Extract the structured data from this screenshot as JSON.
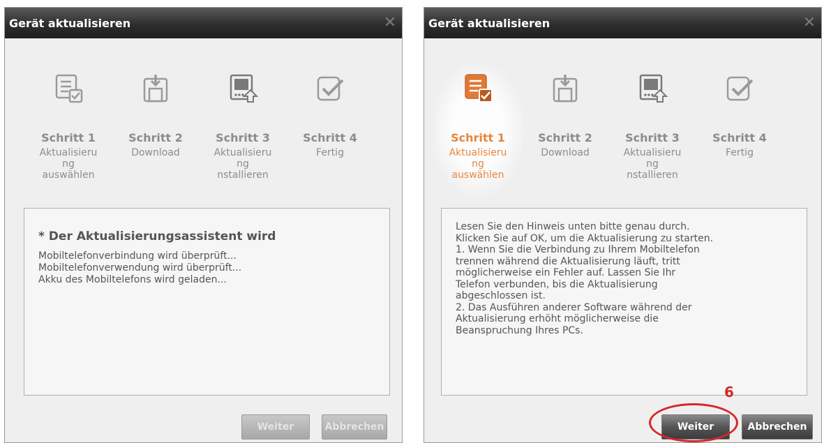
{
  "dialogs": [
    {
      "title": "Gerät aktualisieren",
      "close_symbol": "✕",
      "steps": [
        {
          "name": "Schritt 1",
          "desc_lines": [
            "Aktualisieru",
            "ng",
            "auswählen"
          ],
          "icon": "checklist-icon"
        },
        {
          "name": "Schritt 2",
          "desc_lines": [
            "Download"
          ],
          "icon": "download-icon"
        },
        {
          "name": "Schritt 3",
          "desc_lines": [
            "Aktualisieru",
            "ng",
            "nstallieren"
          ],
          "icon": "install-icon"
        },
        {
          "name": "Schritt 4",
          "desc_lines": [
            "Fertig"
          ],
          "icon": "done-check-icon"
        }
      ],
      "heading": "* Der Aktualisierungsassistent wird",
      "lines": [
        "Mobiltelefonverbindung wird überprüft...",
        "Mobiltelefonverwendung wird überprüft...",
        "Akku des Mobiltelefons wird geladen..."
      ],
      "buttons": {
        "next": "Weiter",
        "cancel": "Abbrechen"
      }
    },
    {
      "title": "Gerät aktualisieren",
      "close_symbol": "✕",
      "steps": [
        {
          "name": "Schritt 1",
          "desc_lines": [
            "Aktualisieru",
            "ng",
            "auswählen"
          ],
          "icon": "checklist-icon"
        },
        {
          "name": "Schritt 2",
          "desc_lines": [
            "Download"
          ],
          "icon": "download-icon"
        },
        {
          "name": "Schritt 3",
          "desc_lines": [
            "Aktualisieru",
            "ng",
            "nstallieren"
          ],
          "icon": "install-icon"
        },
        {
          "name": "Schritt 4",
          "desc_lines": [
            "Fertig"
          ],
          "icon": "done-check-icon"
        }
      ],
      "lines": [
        "Lesen Sie den Hinweis unten bitte genau durch.",
        "Klicken Sie auf OK, um die Aktualisierung zu starten.",
        "1. Wenn Sie die Verbindung zu Ihrem Mobiltelefon",
        "trennen während die Aktualisierung läuft, tritt",
        "möglicherweise ein Fehler auf. Lassen Sie Ihr",
        "Telefon verbunden, bis die Aktualisierung",
        "abgeschlossen ist.",
        "2. Das Ausführen anderer Software während der",
        "Aktualisierung erhöht möglicherweise die",
        "Beanspruchung Ihres PCs."
      ],
      "buttons": {
        "next": "Weiter",
        "cancel": "Abbrechen"
      }
    }
  ],
  "annotation": {
    "number": "6",
    "color": "#d8262a"
  },
  "colors": {
    "active_step": "#e8863c",
    "inactive_step": "#8c8c8c",
    "titlebar": "#2e2e2e"
  }
}
